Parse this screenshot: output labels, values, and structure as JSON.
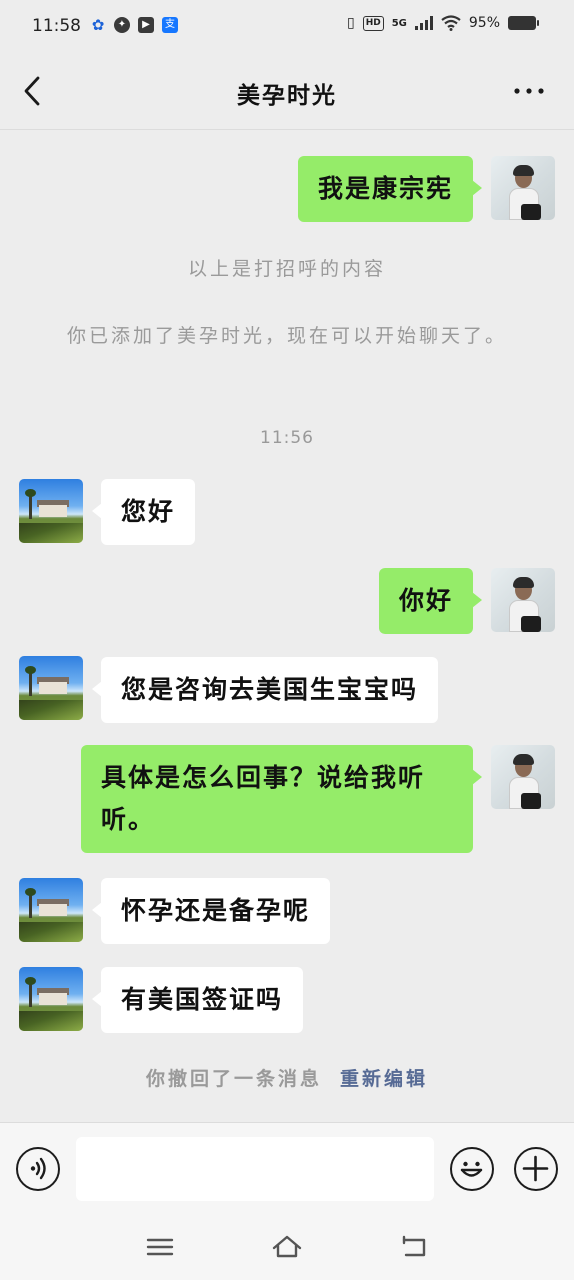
{
  "status_bar": {
    "time": "11:58",
    "app_icons": [
      "paw-print-icon",
      "compass-icon",
      "play-icon",
      "alipay-icon"
    ],
    "hd_label": "HD",
    "network_label": "5G",
    "battery": "95%"
  },
  "header": {
    "title": "美孕时光",
    "back_icon": "back-chevron-icon",
    "more_icon": "more-dots-icon"
  },
  "messages": [
    {
      "side": "self",
      "text": "我是康宗宪"
    },
    {
      "side": "system",
      "text": "以上是打招呼的内容"
    },
    {
      "side": "system",
      "text": "你已添加了美孕时光，现在可以开始聊天了。"
    },
    {
      "side": "timestamp",
      "text": "11:56"
    },
    {
      "side": "other",
      "text": "您好"
    },
    {
      "side": "self",
      "text": "你好"
    },
    {
      "side": "other",
      "text": "您是咨询去美国生宝宝吗"
    },
    {
      "side": "self",
      "text": "具体是怎么回事？说给我听听。"
    },
    {
      "side": "other",
      "text": "怀孕还是备孕呢"
    },
    {
      "side": "other",
      "text": "有美国签证吗"
    }
  ],
  "recall": {
    "text": "你撤回了一条消息",
    "reedit_label": "重新编辑"
  },
  "input_bar": {
    "voice_icon": "voice-icon",
    "placeholder": "",
    "emoji_icon": "emoji-icon",
    "plus_icon": "plus-icon"
  },
  "nav_bar": {
    "icons": [
      "menu-icon",
      "home-icon",
      "back-icon"
    ]
  },
  "colors": {
    "self_bubble": "#95ec69",
    "other_bubble": "#ffffff",
    "background": "#ededed",
    "link": "#576b95"
  }
}
